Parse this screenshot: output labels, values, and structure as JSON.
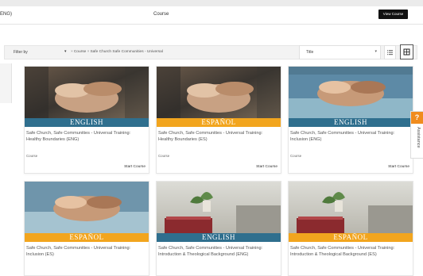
{
  "header": {
    "left_text": "ENG)",
    "center_text": "Course",
    "view_course_label": "View Course"
  },
  "filter": {
    "label": "Filter by",
    "chips": [
      {
        "label": "Course"
      },
      {
        "label": "Safe Church Safe Communities - Universal"
      }
    ]
  },
  "sort": {
    "label": "Title"
  },
  "assistance": {
    "label": "Assistance",
    "badge": "?"
  },
  "colors": {
    "english_band": "#2f6f8e",
    "espanol_band": "#f2a51e",
    "assist_badge": "#f08c1e"
  },
  "cards": [
    {
      "band": "ENGLISH",
      "band_color": "#2f6f8e",
      "image": "stacked-hands-photo",
      "title": "Safe Church, Safe Communities - Universal Training: Healthy Boundaries (ENG)",
      "type": "Course",
      "action": "Start Course"
    },
    {
      "band": "ESPAÑOL",
      "band_color": "#f2a51e",
      "image": "stacked-hands-photo",
      "title": "Safe Church, Safe Communities - Universal Training: Healthy Boundaries (ES)",
      "type": "Course",
      "action": "Start Course"
    },
    {
      "band": "ENGLISH",
      "band_color": "#2f6f8e",
      "image": "stacked-hands-photo",
      "title": "Safe Church, Safe Communities - Universal Training: Inclusion (ENG)",
      "type": "Course",
      "action": "Start Course"
    },
    {
      "band": "ESPAÑOL",
      "band_color": "#f2a51e",
      "image": "stacked-hands-photo",
      "title": "Safe Church, Safe Communities - Universal Training: Inclusion (ES)",
      "type": "",
      "action": ""
    },
    {
      "band": "ENGLISH",
      "band_color": "#2f6f8e",
      "image": "bible-and-plant-photo",
      "title": "Safe Church, Safe Communities - Universal Training: Introduction & Theological Background (ENG)",
      "type": "",
      "action": ""
    },
    {
      "band": "ESPAÑOL",
      "band_color": "#f2a51e",
      "image": "bible-and-plant-photo",
      "title": "Safe Church, Safe Communities - Universal Training: Introduction & Theological Background (ES)",
      "type": "",
      "action": ""
    }
  ]
}
